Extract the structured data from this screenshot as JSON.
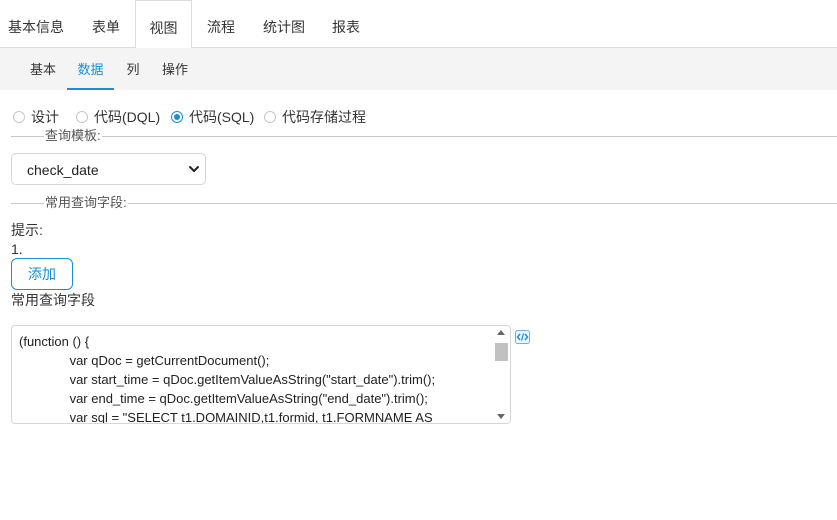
{
  "top_tabs": [
    {
      "label": "基本信息"
    },
    {
      "label": "表单"
    },
    {
      "label": "视图",
      "active": true
    },
    {
      "label": "流程"
    },
    {
      "label": "统计图"
    },
    {
      "label": "报表"
    }
  ],
  "sub_tabs": [
    {
      "label": "基本"
    },
    {
      "label": "数据",
      "active": true
    },
    {
      "label": "列"
    },
    {
      "label": "操作"
    }
  ],
  "radio_options": [
    {
      "label": "设计",
      "checked": false
    },
    {
      "label": "代码(DQL)",
      "checked": false
    },
    {
      "label": "代码(SQL)",
      "checked": true
    },
    {
      "label": "代码存储过程",
      "checked": false
    }
  ],
  "query_template": {
    "legend": "查询模板:",
    "selected": "check_date"
  },
  "common_fields": {
    "legend": "常用查询字段:",
    "hint_label": "提示:",
    "hint_item": "1.",
    "add_button": "添加",
    "field_label": "常用查询字段"
  },
  "code_editor": {
    "lines": [
      "(function () {",
      "              var qDoc = getCurrentDocument();",
      "              var start_time = qDoc.getItemValueAsString(\"start_date\").trim();",
      "              var end_time = qDoc.getItemValueAsString(\"end_date\").trim();",
      "              var sql = \"SELECT t1.DOMAINID,t1.formid, t1.FORMNAME AS"
    ]
  },
  "colors": {
    "accent": "#1a8fd6",
    "sub_bar_bg": "#f4f4f4",
    "border": "#d6d6d6"
  },
  "icons": {
    "select_arrow": "chevron-down-icon",
    "editor_expand": "code-expand-icon"
  }
}
